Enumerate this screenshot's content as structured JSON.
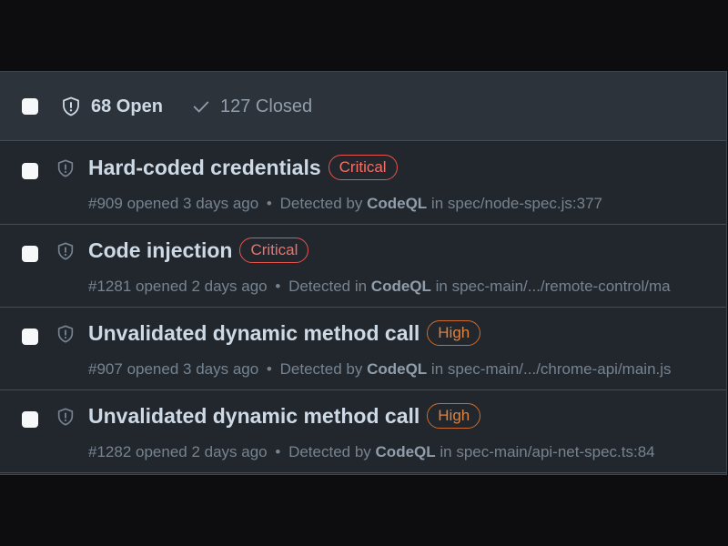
{
  "header": {
    "open_label": "68 Open",
    "closed_label": "127 Closed"
  },
  "alerts": [
    {
      "title": "Hard-coded credentials",
      "severity": "Critical",
      "number": "#909",
      "opened": "opened 3 days ago",
      "separator": "•",
      "detected_prefix": "Detected by",
      "tool": "CodeQL",
      "in_label": "in",
      "location": "spec/node-spec.js:377"
    },
    {
      "title": "Code injection",
      "severity": "Critical",
      "number": "#1281",
      "opened": "opened 2 days ago",
      "separator": "•",
      "detected_prefix": "Detected in",
      "tool": "CodeQL",
      "in_label": "in",
      "location": "spec-main/.../remote-control/ma"
    },
    {
      "title": "Unvalidated dynamic method call",
      "severity": "High",
      "number": "#907",
      "opened": "opened 3 days ago",
      "separator": "•",
      "detected_prefix": "Detected by",
      "tool": "CodeQL",
      "in_label": "in",
      "location": "spec-main/.../chrome-api/main.js"
    },
    {
      "title": "Unvalidated dynamic method call",
      "severity": "High",
      "number": "#1282",
      "opened": "opened 2 days ago",
      "separator": "•",
      "detected_prefix": "Detected by",
      "tool": "CodeQL",
      "in_label": "in",
      "location": "spec-main/api-net-spec.ts:84"
    }
  ],
  "colors": {
    "background": "#0d0d0f",
    "panel": "#22272e",
    "header": "#2d333b",
    "critical": "#f47067",
    "high": "#e0823d"
  },
  "icons": {
    "open": "shield-icon",
    "closed": "check-icon",
    "row": "shield-icon"
  }
}
